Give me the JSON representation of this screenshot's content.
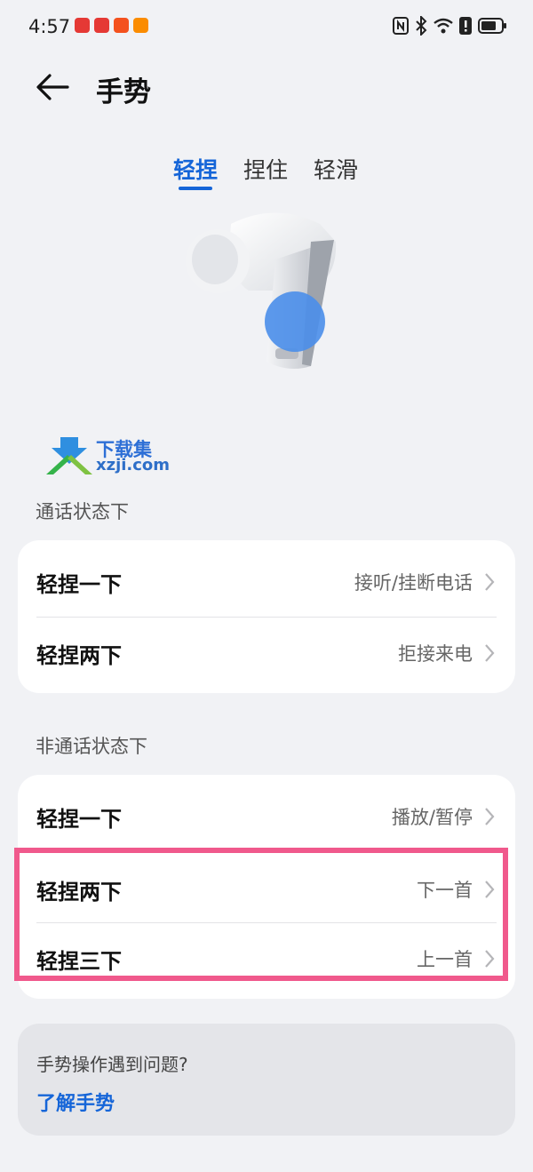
{
  "status_bar": {
    "time": "4:57",
    "notification_icons": [
      "app-icon-red",
      "huawei-brand-icon",
      "game-icon",
      "video-icon"
    ],
    "system_icons": [
      "nfc-icon",
      "bluetooth-icon",
      "wifi-icon",
      "alert-icon",
      "battery-icon"
    ]
  },
  "header": {
    "title": "手势"
  },
  "tabs": [
    {
      "label": "轻捏"
    },
    {
      "label": "捏住"
    },
    {
      "label": "轻滑"
    }
  ],
  "watermark": {
    "title": "下载集",
    "url": "xzji.com"
  },
  "in_call": {
    "section_label": "通话状态下",
    "rows": [
      {
        "label": "轻捏一下",
        "value": "接听/挂断电话"
      },
      {
        "label": "轻捏两下",
        "value": "拒接来电"
      }
    ]
  },
  "not_in_call": {
    "section_label": "非通话状态下",
    "rows": [
      {
        "label": "轻捏一下",
        "value": "播放/暂停"
      },
      {
        "label": "轻捏两下",
        "value": "下一首"
      },
      {
        "label": "轻捏三下",
        "value": "上一首"
      }
    ]
  },
  "help": {
    "question": "手势操作遇到问题?",
    "link": "了解手势"
  },
  "colors": {
    "accent": "#1565d8",
    "highlight": "#f0598c",
    "background": "#f1f2f5"
  }
}
